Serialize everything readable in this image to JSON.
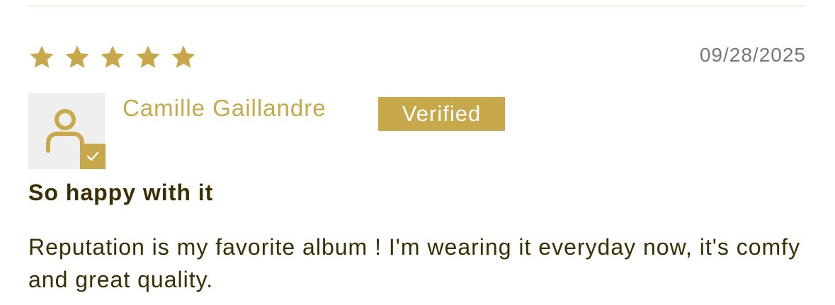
{
  "review": {
    "rating": 5,
    "rating_max": 5,
    "date": "09/28/2025",
    "reviewer_name": "Camille Gaillandre",
    "verified_label": "Verified",
    "title": "So happy with it",
    "body": "Reputation is my favorite album ! I'm wearing it everyday now, it's comfy and great quality."
  },
  "icons": {
    "star": "star-icon",
    "avatar": "user-icon",
    "check": "check-icon"
  },
  "colors": {
    "accent": "#c7a84b",
    "text": "#3b2e00",
    "muted": "#777777",
    "avatar_bg": "#efefef"
  }
}
